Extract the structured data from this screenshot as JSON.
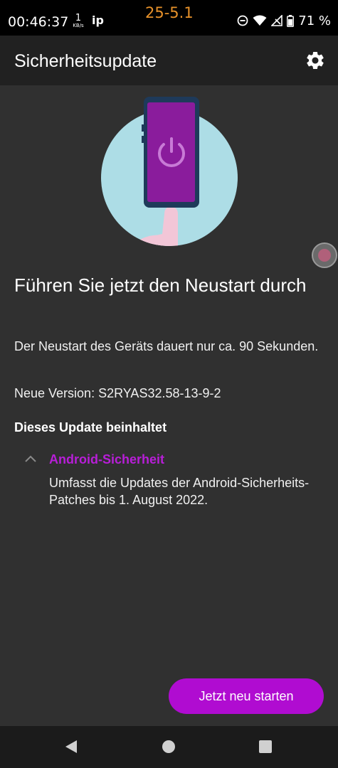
{
  "status_bar": {
    "time": "00:46:37",
    "speed_value": "1",
    "speed_unit": "KB/s",
    "network_label": "ip",
    "center_label": "25-5.1",
    "battery_percent": "71 %",
    "icons": [
      "dnd-icon",
      "wifi-icon",
      "signal-icon",
      "battery-icon"
    ]
  },
  "app_bar": {
    "title": "Sicherheitsupdate",
    "settings_icon": "gear-icon"
  },
  "content": {
    "headline": "Führen Sie jetzt den Neustart durch",
    "description": "Der Neustart des Geräts dauert nur ca. 90 Sekunden.",
    "version": "Neue Version: S2RYAS32.58-13-9-2",
    "includes_heading": "Dieses Update beinhaltet",
    "accordion": {
      "title": "Android-Sicherheit",
      "expanded": true,
      "text": "Umfasst die Updates der Android-Sicherheits-Patches bis 1. August 2022."
    }
  },
  "actions": {
    "restart_label": "Jetzt neu starten"
  },
  "colors": {
    "accent": "#b00cd1",
    "accent_text": "#b81ed8",
    "background": "#303030",
    "appbar": "#212121",
    "status_center": "#e8922a"
  },
  "nav_bar": {
    "icons": [
      "back-icon",
      "home-icon",
      "recents-icon"
    ]
  }
}
